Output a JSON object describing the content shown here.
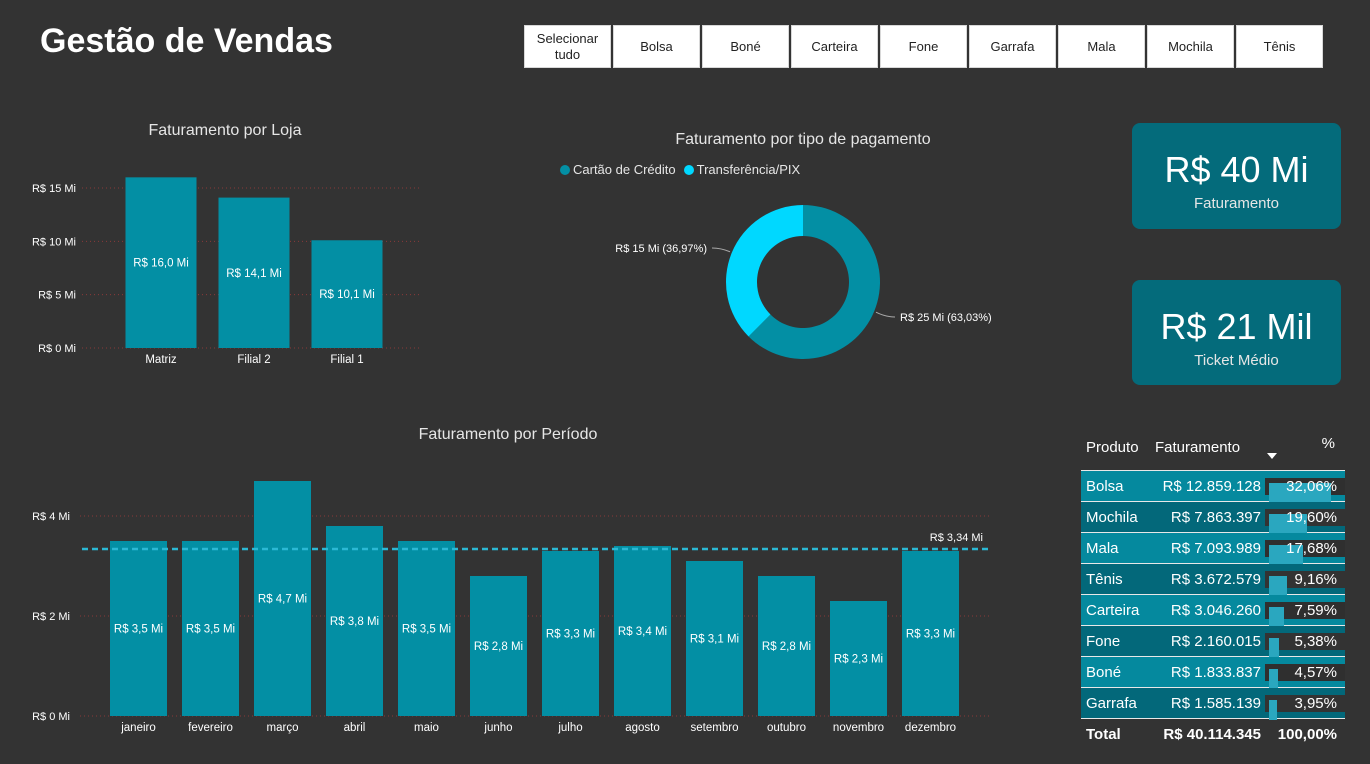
{
  "header": {
    "title": "Gestão de Vendas"
  },
  "slicer": [
    "Selecionar tudo",
    "Bolsa",
    "Boné",
    "Carteira",
    "Fone",
    "Garrafa",
    "Mala",
    "Mochila",
    "Tênis"
  ],
  "kpis": [
    {
      "value": "R$ 40 Mi",
      "label": "Faturamento"
    },
    {
      "value": "R$ 21 Mil",
      "label": "Ticket Médio"
    }
  ],
  "table": {
    "headers": {
      "produto": "Produto",
      "faturamento": "Faturamento",
      "pct": "%",
      "sort_icon": "sort-down-icon"
    },
    "rows": [
      {
        "produto": "Bolsa",
        "faturamento": "R$ 12.859.128",
        "pct": "32,06%",
        "frac": 0.3206
      },
      {
        "produto": "Mochila",
        "faturamento": "R$ 7.863.397",
        "pct": "19,60%",
        "frac": 0.196
      },
      {
        "produto": "Mala",
        "faturamento": "R$ 7.093.989",
        "pct": "17,68%",
        "frac": 0.1768
      },
      {
        "produto": "Tênis",
        "faturamento": "R$ 3.672.579",
        "pct": "9,16%",
        "frac": 0.0916
      },
      {
        "produto": "Carteira",
        "faturamento": "R$ 3.046.260",
        "pct": "7,59%",
        "frac": 0.0759
      },
      {
        "produto": "Fone",
        "faturamento": "R$ 2.160.015",
        "pct": "5,38%",
        "frac": 0.0538
      },
      {
        "produto": "Boné",
        "faturamento": "R$ 1.833.837",
        "pct": "4,57%",
        "frac": 0.0457
      },
      {
        "produto": "Garrafa",
        "faturamento": "R$ 1.585.139",
        "pct": "3,95%",
        "frac": 0.0395
      }
    ],
    "total": {
      "produto": "Total",
      "faturamento": "R$ 40.114.345",
      "pct": "100,00%"
    }
  },
  "colors": {
    "bar": "#038fa4",
    "pix": "#00d8ff",
    "kpi_bg": "#046b7b",
    "row_dark": "#03687a",
    "row_light": "#05899e",
    "avg_line": "#2bb8d4"
  },
  "chart_data": [
    {
      "type": "bar",
      "title": "Faturamento por Loja",
      "categories": [
        "Matriz",
        "Filial 2",
        "Filial 1"
      ],
      "values": [
        16.0,
        14.1,
        10.1
      ],
      "data_labels": [
        "R$ 16,0 Mi",
        "R$ 14,1 Mi",
        "R$ 10,1 Mi"
      ],
      "yticks": [
        0,
        5,
        10,
        15
      ],
      "ytick_labels": [
        "R$ 0 Mi",
        "R$ 5 Mi",
        "R$ 10 Mi",
        "R$ 15 Mi"
      ],
      "ylim": [
        0,
        16
      ],
      "grid": true
    },
    {
      "type": "pie",
      "title": "Faturamento por tipo de pagamento",
      "donut": true,
      "legend": "top-left",
      "labels": [
        "Cartão de Crédito",
        "Transferência/PIX"
      ],
      "values": [
        25,
        15
      ],
      "percents": [
        63.03,
        36.97
      ],
      "data_labels": [
        "R$ 25 Mi (63,03%)",
        "R$ 15 Mi (36,97%)"
      ]
    },
    {
      "type": "bar",
      "title": "Faturamento por Período",
      "categories": [
        "janeiro",
        "fevereiro",
        "março",
        "abril",
        "maio",
        "junho",
        "julho",
        "agosto",
        "setembro",
        "outubro",
        "novembro",
        "dezembro"
      ],
      "values": [
        3.5,
        3.5,
        4.7,
        3.8,
        3.5,
        2.8,
        3.3,
        3.4,
        3.1,
        2.8,
        2.3,
        3.3
      ],
      "data_labels": [
        "R$ 3,5 Mi",
        "R$ 3,5 Mi",
        "R$ 4,7 Mi",
        "R$ 3,8 Mi",
        "R$ 3,5 Mi",
        "R$ 2,8 Mi",
        "R$ 3,3 Mi",
        "R$ 3,4 Mi",
        "R$ 3,1 Mi",
        "R$ 2,8 Mi",
        "R$ 2,3 Mi",
        "R$ 3,3 Mi"
      ],
      "yticks": [
        0,
        2,
        4
      ],
      "ytick_labels": [
        "R$ 0 Mi",
        "R$ 2 Mi",
        "R$ 4 Mi"
      ],
      "ylim": [
        0,
        4.7
      ],
      "average": 3.34,
      "average_label": "R$ 3,34 Mi",
      "grid": true
    }
  ]
}
